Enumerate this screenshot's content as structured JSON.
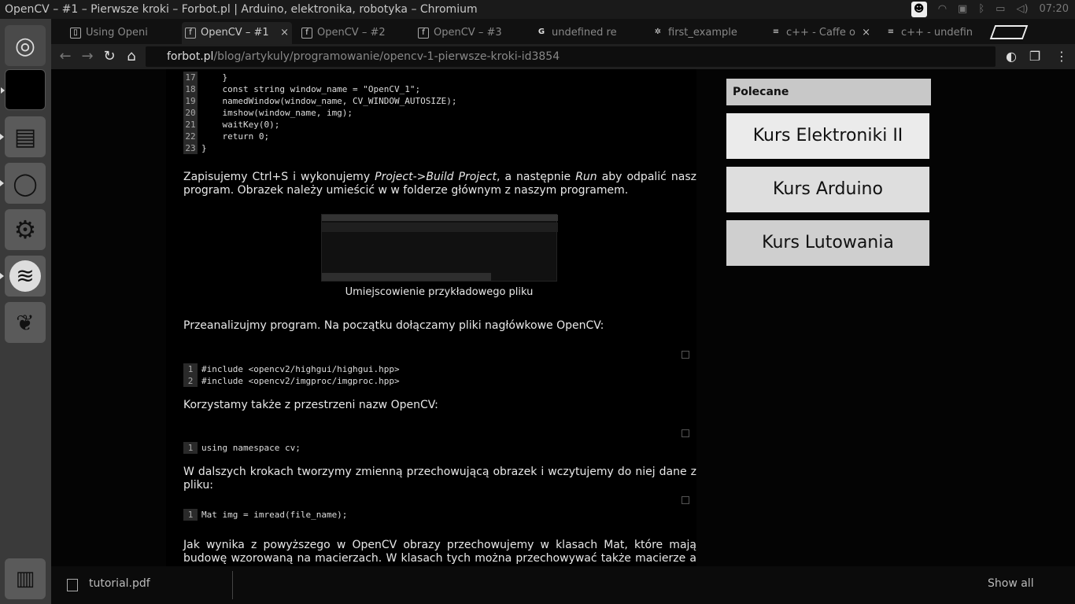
{
  "window": {
    "title": "OpenCV – #1 – Pierwsze kroki – Forbot.pl | Arduino, elektronika, robotyka – Chromium",
    "clock": "07:20"
  },
  "launcher": {
    "items": [
      {
        "name": "ubuntu-dash-icon",
        "glyph": "◎"
      },
      {
        "name": "terminal-icon",
        "glyph": ""
      },
      {
        "name": "files-icon",
        "glyph": "▤"
      },
      {
        "name": "chromium-icon",
        "glyph": "◯"
      },
      {
        "name": "settings-icon",
        "glyph": "⚙"
      },
      {
        "name": "spotify-icon",
        "glyph": "≋"
      },
      {
        "name": "stm32-icon",
        "glyph": "❦"
      },
      {
        "name": "trash-icon",
        "glyph": "🗑"
      }
    ]
  },
  "tabs": [
    {
      "label": "Using Openi",
      "icon": "doc"
    },
    {
      "label": "OpenCV – #1",
      "icon": "f",
      "active": true
    },
    {
      "label": "OpenCV – #2",
      "icon": "f"
    },
    {
      "label": "OpenCV – #3",
      "icon": "f"
    },
    {
      "label": "undefined re",
      "icon": "G"
    },
    {
      "label": "first_example",
      "icon": "cog"
    },
    {
      "label": "c++ - Caffe o",
      "icon": "so"
    },
    {
      "label": "c++ - undefin",
      "icon": "so"
    }
  ],
  "address": {
    "host": "forbot.pl",
    "path": "/blog/artykuly/programowanie/opencv-1-pierwsze-kroki-id3854"
  },
  "code_top": {
    "lines": [
      {
        "n": "17",
        "code": "    }"
      },
      {
        "n": "18",
        "code": "    const string window_name = \"OpenCV_1\";"
      },
      {
        "n": "19",
        "code": "    namedWindow(window_name, CV_WINDOW_AUTOSIZE);"
      },
      {
        "n": "20",
        "code": "    imshow(window_name, img);"
      },
      {
        "n": "21",
        "code": "    waitKey(0);"
      },
      {
        "n": "22",
        "code": "    return 0;"
      },
      {
        "n": "23",
        "code": "}"
      }
    ]
  },
  "para1": {
    "a": "Zapisujemy Ctrl+S i wykonujemy ",
    "b": "Project->Build Project",
    "c": ", a następnie ",
    "d": "Run",
    "e": " aby odpalić nasz program. Obrazek należy umieścić w w folderze głównym z naszym programem."
  },
  "figure_caption": "Umiejscowienie przykładowego pliku",
  "para2": "Przeanalizujmy program. Na początku dołączamy pliki nagłówkowe OpenCV:",
  "code_includes": [
    {
      "n": "1",
      "code": "#include <opencv2/highgui/highgui.hpp>"
    },
    {
      "n": "2",
      "code": "#include <opencv2/imgproc/imgproc.hpp>"
    }
  ],
  "para3": "Korzystamy także z przestrzeni nazw OpenCV:",
  "code_namespace": [
    {
      "n": "1",
      "code": "using namespace cv;"
    }
  ],
  "para4": "W dalszych krokach tworzymy zmienną przechowującą obrazek i wczytujemy do niej dane z pliku:",
  "code_imread": [
    {
      "n": "1",
      "code": "Mat img = imread(file_name);"
    }
  ],
  "para5": "Jak wynika z powyższego w OpenCV obrazy przechowujemy w klasach Mat, które mają budowę wzorowaną na macierzach. W klasach tych można przechowywać także macierze a OpenCV",
  "sidebar": {
    "heading": "Polecane",
    "courses": [
      {
        "label": "Kurs Elektroniki II",
        "bg": "#ebebeb"
      },
      {
        "label": "Kurs Arduino",
        "bg": "#dedede"
      },
      {
        "label": "Kurs Lutowania",
        "bg": "#cfcfcf"
      }
    ]
  },
  "downloads": {
    "file": "tutorial.pdf",
    "show_all": "Show all"
  }
}
